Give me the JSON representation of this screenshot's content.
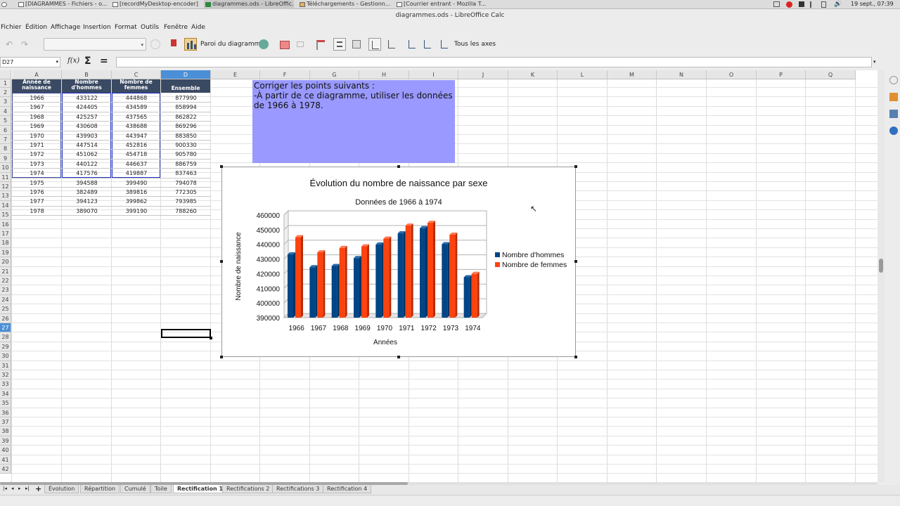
{
  "taskbar": {
    "items": [
      "[DIAGRAMMES - Fichiers - o...",
      "[recordMyDesktop-encoder]",
      "diagrammes.ods - LibreOffic...",
      "Téléchargements - Gestionn...",
      "[Courrier entrant - Mozilla T..."
    ],
    "clock": "19 sept., 07:39"
  },
  "window": {
    "title": "diagrammes.ods - LibreOffice Calc"
  },
  "menu": [
    "Fichier",
    "Édition",
    "Affichage",
    "Insertion",
    "Format",
    "Outils",
    "Fenêtre",
    "Aide"
  ],
  "toolbar": {
    "chart_wall_label": "Paroi du diagramme",
    "all_axes_label": "Tous les axes"
  },
  "formula": {
    "name_box": "D27",
    "value": ""
  },
  "columns": [
    "A",
    "B",
    "C",
    "D",
    "E",
    "F",
    "G",
    "H",
    "I",
    "J",
    "K",
    "L",
    "M",
    "N",
    "O",
    "P",
    "Q"
  ],
  "table": {
    "headers": [
      "Année de naissance",
      "Nombre d'hommes",
      "Nombre de femmes",
      "Ensemble"
    ],
    "rows": [
      [
        "1966",
        "433122",
        "444868",
        "877990"
      ],
      [
        "1967",
        "424405",
        "434589",
        "858994"
      ],
      [
        "1968",
        "425257",
        "437565",
        "862822"
      ],
      [
        "1969",
        "430608",
        "438688",
        "869296"
      ],
      [
        "1970",
        "439903",
        "443947",
        "883850"
      ],
      [
        "1971",
        "447514",
        "452816",
        "900330"
      ],
      [
        "1972",
        "451062",
        "454718",
        "905780"
      ],
      [
        "1973",
        "440122",
        "446637",
        "886759"
      ],
      [
        "1974",
        "417576",
        "419887",
        "837463"
      ],
      [
        "1975",
        "394588",
        "399490",
        "794078"
      ],
      [
        "1976",
        "382489",
        "389816",
        "772305"
      ],
      [
        "1977",
        "394123",
        "399862",
        "793985"
      ],
      [
        "1978",
        "389070",
        "399190",
        "788260"
      ]
    ]
  },
  "note": {
    "lines": [
      "Corriger les points suivants :",
      "-À partir de ce diagramme, utiliser les données de 1966 à 1978."
    ]
  },
  "chart_data": {
    "type": "bar",
    "title": "Évolution du nombre de naissance par sexe",
    "subtitle": "Données de 1966 à 1974",
    "xlabel": "Années",
    "ylabel": "Nombre de naissance",
    "categories": [
      "1966",
      "1967",
      "1968",
      "1969",
      "1970",
      "1971",
      "1972",
      "1973",
      "1974"
    ],
    "series": [
      {
        "name": "Nombre d'hommes",
        "color": "#004586",
        "values": [
          433122,
          424405,
          425257,
          430608,
          439903,
          447514,
          451062,
          440122,
          417576
        ]
      },
      {
        "name": "Nombre de femmes",
        "color": "#ff420e",
        "values": [
          444868,
          434589,
          437565,
          438688,
          443947,
          452816,
          454718,
          446637,
          419887
        ]
      }
    ],
    "ylim": [
      390000,
      460000
    ],
    "yticks": [
      "390000",
      "400000",
      "410000",
      "420000",
      "430000",
      "440000",
      "450000",
      "460000"
    ],
    "legend": "right",
    "grid": true
  },
  "sheet_tabs": {
    "tabs": [
      "Évolution",
      "Répartition",
      "Cumulé",
      "Toile",
      "Rectification 1",
      "Rectifications 2",
      "Rectifications 3",
      "Rectification 4"
    ],
    "active": "Rectification 1"
  },
  "colors": {
    "header_bg": "#3b4a63",
    "note_bg": "#9999ff",
    "selected_col": "#4a8fd8"
  }
}
